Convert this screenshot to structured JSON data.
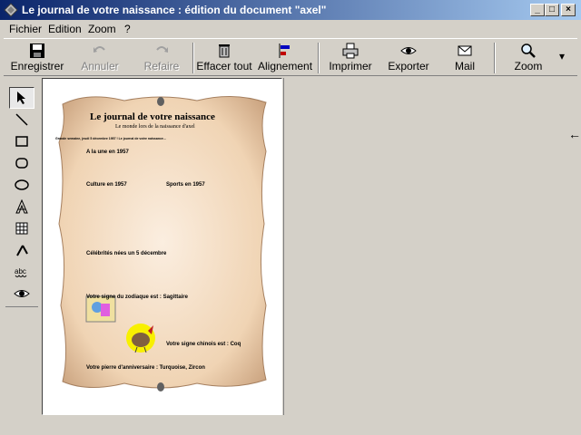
{
  "window": {
    "title": "Le journal de votre naissance : édition du document \"axel\"",
    "buttons": {
      "minimize": "_",
      "maximize": "□",
      "close": "×"
    }
  },
  "menu": [
    {
      "label": "Fichier"
    },
    {
      "label": "Edition"
    },
    {
      "label": "Zoom"
    },
    {
      "label": "?"
    }
  ],
  "toolbar": {
    "save": "Enregistrer",
    "undo": "Annuler",
    "redo": "Refaire",
    "clear": "Effacer tout",
    "align": "Alignement",
    "print": "Imprimer",
    "export": "Exporter",
    "mail": "Mail",
    "zoom": "Zoom"
  },
  "tools": [
    {
      "icon": "pointer-icon"
    },
    {
      "icon": "line-icon"
    },
    {
      "icon": "rectangle-icon"
    },
    {
      "icon": "rounded-rectangle-icon"
    },
    {
      "icon": "ellipse-icon"
    },
    {
      "icon": "text-icon"
    },
    {
      "icon": "image-icon"
    },
    {
      "icon": "crop-icon"
    },
    {
      "icon": "spellcheck-icon"
    },
    {
      "icon": "preview-eye-icon"
    }
  ],
  "document": {
    "title": "Le journal de votre naissance",
    "subtitle": "Le monde lors de la naissance d'axel",
    "intro": "Grande semaine, jeudi 5 décembre 1957 ! Le journal de votre naissance...",
    "sections": {
      "news": "A la une en 1957",
      "culture": "Culture en 1957",
      "sports": "Sports en 1957",
      "celebrities": "Célébrités nées un 5 décembre",
      "zodiac": "Votre signe du zodiaque est : Sagittaire",
      "chinese": "Votre signe chinois est : Coq",
      "stones": "Votre pierre d'anniversaire : Turquoise, Zircon"
    }
  },
  "colors": {
    "titlebar_start": "#0a246a",
    "titlebar_end": "#a6caf0",
    "paper": "#f0d4b4",
    "paper_edge": "#a68060",
    "chrome": "#d4d0c8"
  }
}
